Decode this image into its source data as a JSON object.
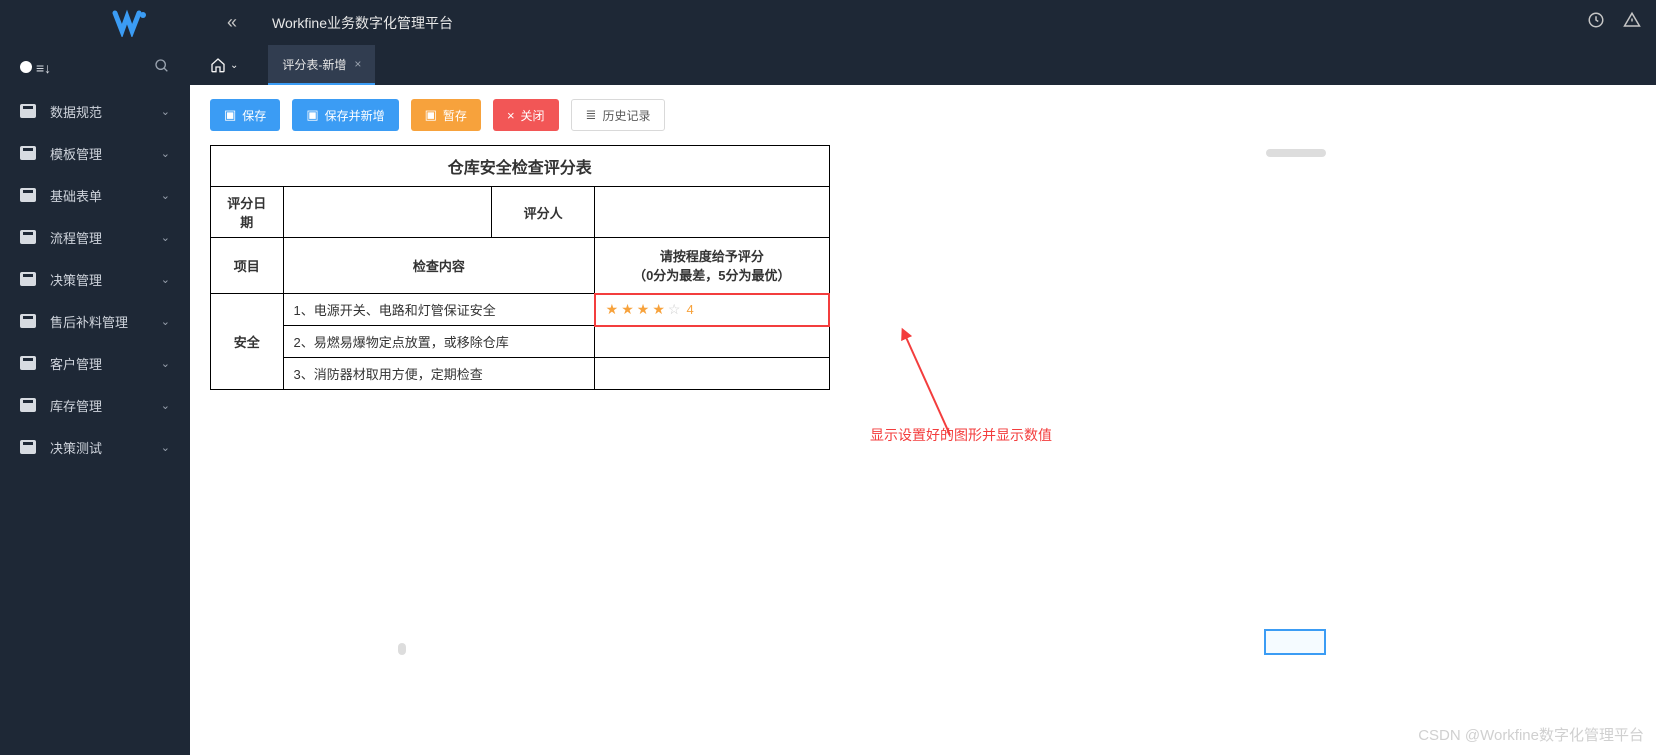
{
  "header": {
    "app_title": "Workfine业务数字化管理平台"
  },
  "sidebar": {
    "items": [
      {
        "label": "数据规范"
      },
      {
        "label": "模板管理"
      },
      {
        "label": "基础表单"
      },
      {
        "label": "流程管理"
      },
      {
        "label": "决策管理"
      },
      {
        "label": "售后补料管理"
      },
      {
        "label": "客户管理"
      },
      {
        "label": "库存管理"
      },
      {
        "label": "决策测试"
      }
    ]
  },
  "tabs": {
    "active": {
      "label": "评分表-新增"
    }
  },
  "toolbar": {
    "save": "保存",
    "save_new": "保存并新增",
    "draft": "暂存",
    "close": "关闭",
    "history": "历史记录"
  },
  "sheet": {
    "title": "仓库安全检查评分表",
    "date_label": "评分日期",
    "person_label": "评分人",
    "col_project": "项目",
    "col_content": "检查内容",
    "col_rating_line1": "请按程度给予评分",
    "col_rating_line2": "（0分为最差，5分为最优）",
    "group_label": "安全",
    "rows": [
      {
        "no": "1、",
        "text": "电源开关、电路和灯管保证安全",
        "rating": 4
      },
      {
        "no": "2、",
        "text": "易燃易爆物定点放置，或移除仓库",
        "rating": null
      },
      {
        "no": "3、",
        "text": "消防器材取用方便，定期检查",
        "rating": null
      }
    ]
  },
  "annotation": "显示设置好的图形并显示数值",
  "watermark": "CSDN @Workfine数字化管理平台"
}
